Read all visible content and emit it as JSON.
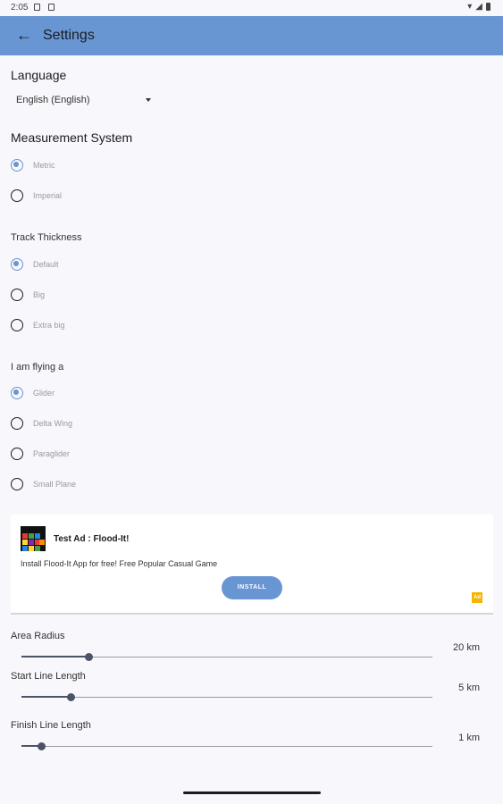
{
  "status_bar": {
    "time": "2:05"
  },
  "app_bar": {
    "back_icon": "arrow-left-icon",
    "title": "Settings"
  },
  "language": {
    "title": "Language",
    "selected": "English (English)"
  },
  "measurement": {
    "title": "Measurement System",
    "options": [
      {
        "label": "Metric",
        "selected": true
      },
      {
        "label": "Imperial",
        "selected": false
      }
    ]
  },
  "track": {
    "title": "Track Thickness",
    "options": [
      {
        "label": "Default",
        "selected": true
      },
      {
        "label": "Big",
        "selected": false
      },
      {
        "label": "Extra big",
        "selected": false
      }
    ]
  },
  "flying": {
    "title": "I am flying a",
    "options": [
      {
        "label": "Glider",
        "selected": true
      },
      {
        "label": "Delta Wing",
        "selected": false
      },
      {
        "label": "Paraglider",
        "selected": false
      },
      {
        "label": "Small Plane",
        "selected": false
      }
    ]
  },
  "ad": {
    "title": "Test Ad : Flood-It!",
    "body": "Install Flood-It App for free! Free Popular Casual Game",
    "install": "INSTALL",
    "badge": "Ad"
  },
  "sliders": [
    {
      "label": "Area Radius",
      "value_text": "20 km",
      "fraction": 0.165
    },
    {
      "label": "Start Line Length",
      "value_text": "5 km",
      "fraction": 0.12
    },
    {
      "label": "Finish Line Length",
      "value_text": "1 km",
      "fraction": 0.048
    }
  ],
  "colors": {
    "accent": "#6896d3",
    "slider": "#4a5466",
    "ad_badge": "#f5b400"
  }
}
